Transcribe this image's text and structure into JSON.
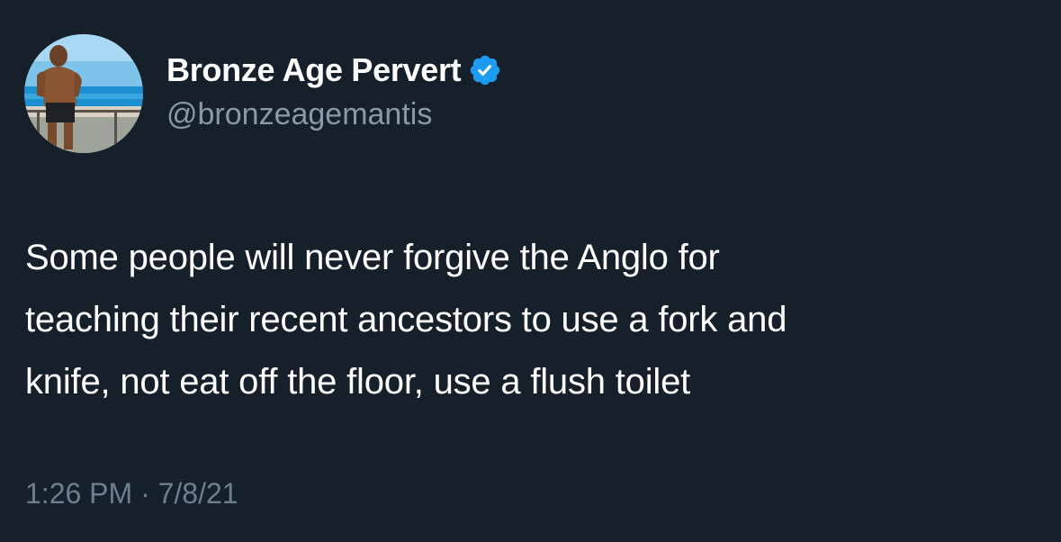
{
  "author": {
    "display_name": "Bronze Age Pervert",
    "handle": "@bronzeagemantis",
    "verified": true,
    "avatar_icon": "profile-photo"
  },
  "tweet": {
    "lines": [
      "Some people will never forgive the Anglo for",
      "teaching their recent ancestors to use a fork and",
      "knife, not eat off the floor, use a flush toilet"
    ],
    "time": "1:26 PM",
    "separator": "·",
    "date": "7/8/21"
  },
  "colors": {
    "background": "#15202b",
    "text": "#ffffff",
    "secondary": "#8b98a5",
    "verified_badge": "#1d9bf0"
  }
}
